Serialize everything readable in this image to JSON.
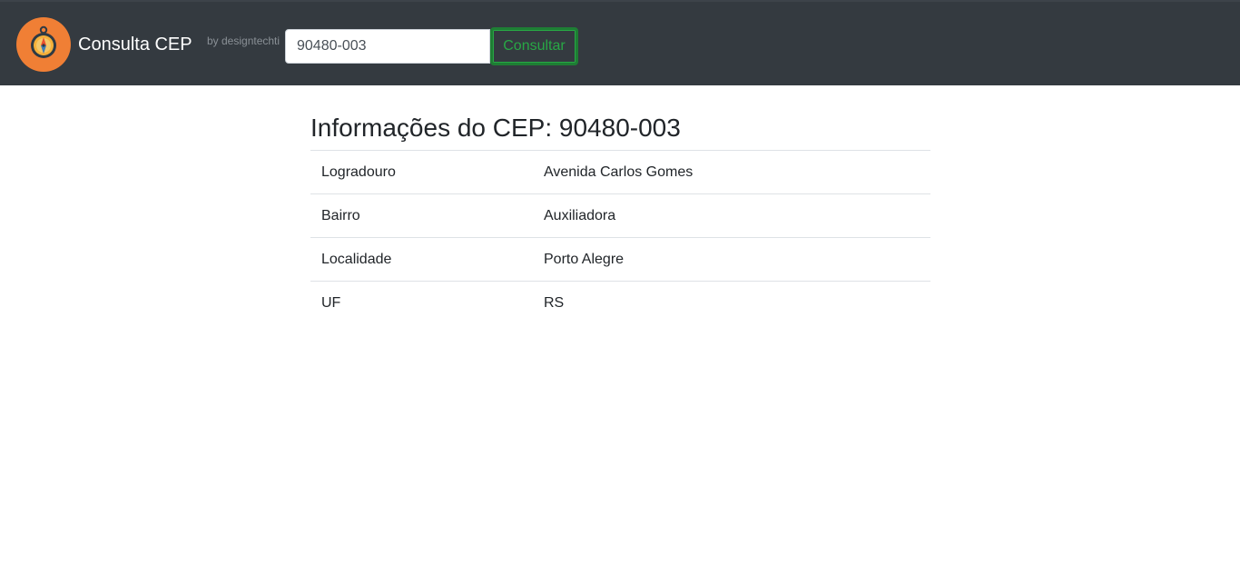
{
  "header": {
    "brand": "Consulta CEP",
    "byline": "by designtechti",
    "search": {
      "value": "90480-003",
      "placeholder": ""
    },
    "search_button_label": "Consultar",
    "logo_icon": "compass-icon",
    "colors": {
      "navbar": "#343a40",
      "logo_circle": "#f07f35",
      "button_accent": "#28a745"
    }
  },
  "main": {
    "title": "Informações do CEP: 90480-003",
    "rows": [
      {
        "label": "Logradouro",
        "value": "Avenida Carlos Gomes"
      },
      {
        "label": "Bairro",
        "value": "Auxiliadora"
      },
      {
        "label": "Localidade",
        "value": "Porto Alegre"
      },
      {
        "label": "UF",
        "value": "RS"
      }
    ]
  }
}
